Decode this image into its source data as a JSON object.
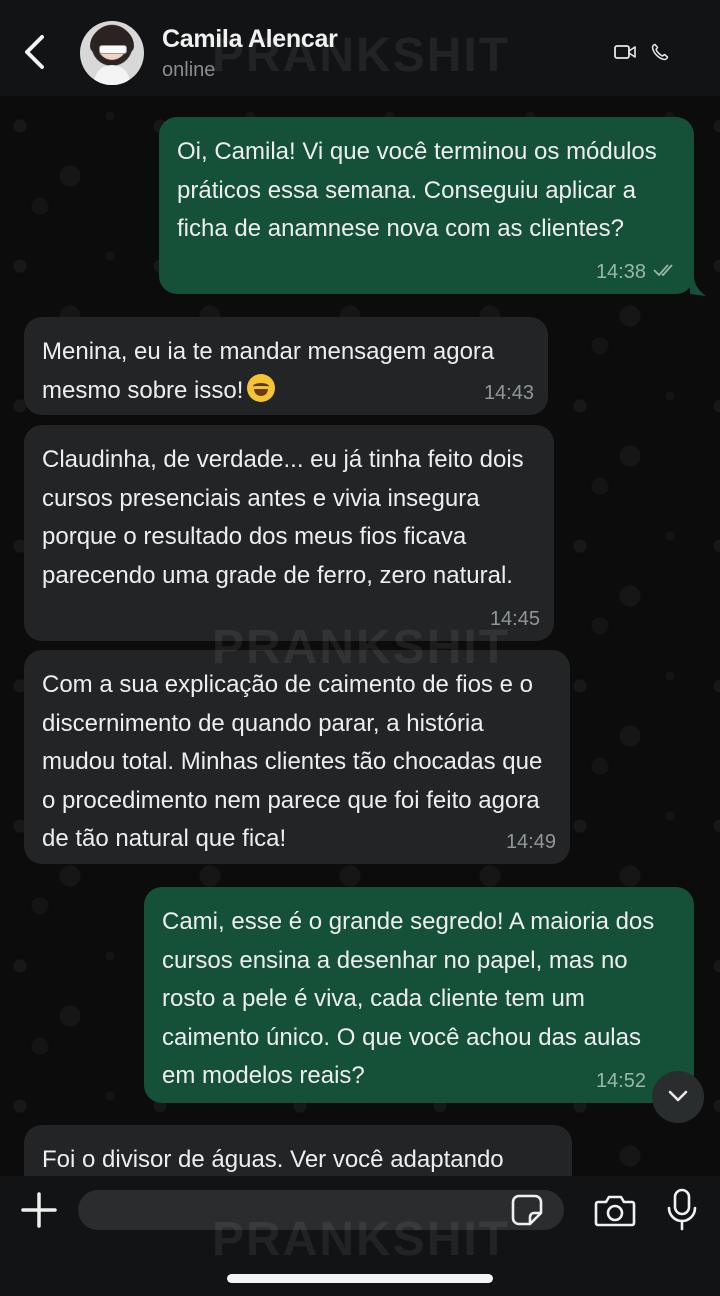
{
  "header": {
    "contact_name": "Camila Alencar",
    "status": "online"
  },
  "watermark": "PRANKSHIT",
  "messages": [
    {
      "direction": "out",
      "text": "Oi, Camila! Vi que você terminou os módulos práticos essa semana. Conseguiu aplicar a ficha de anamnese nova com as clientes?",
      "time": "14:38",
      "read": true
    },
    {
      "direction": "in",
      "text": "Menina, eu ia te mandar mensagem agora mesmo sobre isso!",
      "emoji": "rolling-on-floor-laughing",
      "time": "14:43"
    },
    {
      "direction": "in",
      "text": "Claudinha, de verdade... eu já tinha feito dois cursos presenciais antes e vivia insegura porque o resultado dos meus fios ficava parecendo uma grade de ferro, zero natural.",
      "time": "14:45"
    },
    {
      "direction": "in",
      "text": "Com a sua explicação de caimento de fios e o discernimento de quando parar, a história mudou total. Minhas clientes tão chocadas que o procedimento nem parece que foi feito agora de tão natural que fica!",
      "time": "14:49"
    },
    {
      "direction": "out",
      "text": "Cami, esse é o grande segredo! A maioria dos cursos ensina a desenhar no papel, mas no rosto a pele é viva, cada cliente tem um caimento único. O que você achou das aulas em modelos reais?",
      "time": "14:52"
    },
    {
      "direction": "in",
      "text": "Foi o divisor de águas. Ver você adaptando",
      "time": ""
    }
  ],
  "composer": {
    "placeholder": ""
  },
  "colors": {
    "outgoing_bubble": "#155039",
    "incoming_bubble": "#222425",
    "header": "#111314"
  }
}
